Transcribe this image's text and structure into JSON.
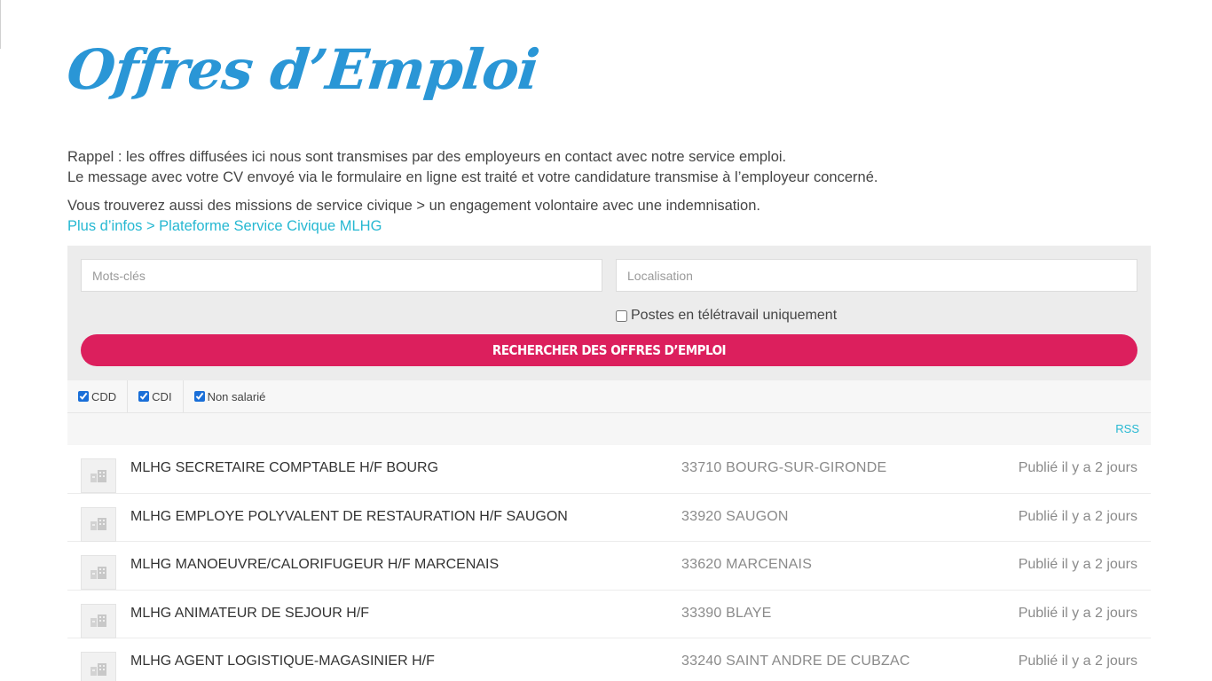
{
  "title": "Offres d’Emploi",
  "intro": {
    "line1": "Rappel : les offres diffusées ici nous sont transmises par des employeurs en contact avec notre service emploi.",
    "line2": "Le message avec votre CV envoyé via le formulaire en ligne est traité et votre candidature transmise à l’employeur concerné.",
    "line3": "Vous trouverez aussi des missions de service civique > un engagement volontaire avec une indemnisation.",
    "link": "Plus d’infos > Plateforme Service Civique MLHG"
  },
  "search": {
    "keywords_placeholder": "Mots-clés",
    "location_placeholder": "Localisation",
    "remote_label": "Postes en télétravail uniquement",
    "button_label": "Rechercher des offres d’emploi"
  },
  "job_types": [
    {
      "label": "CDD",
      "checked": true
    },
    {
      "label": "CDI",
      "checked": true
    },
    {
      "label": "Non salarié",
      "checked": true
    }
  ],
  "rss_label": "RSS",
  "jobs": [
    {
      "title": "MLHG SECRETAIRE COMPTABLE H/F BOURG",
      "location": "33710 BOURG-SUR-GIRONDE",
      "date": "Publié il y a 2 jours"
    },
    {
      "title": "MLHG EMPLOYE POLYVALENT DE RESTAURATION H/F SAUGON",
      "location": "33920 SAUGON",
      "date": "Publié il y a 2 jours"
    },
    {
      "title": "MLHG MANOEUVRE/CALORIFUGEUR H/F MARCENAIS",
      "location": "33620 MARCENAIS",
      "date": "Publié il y a 2 jours"
    },
    {
      "title": "MLHG ANIMATEUR DE SEJOUR H/F",
      "location": "33390 BLAYE",
      "date": "Publié il y a 2 jours"
    },
    {
      "title": "MLHG AGENT LOGISTIQUE-MAGASINIER H/F",
      "location": "33240 SAINT ANDRE DE CUBZAC",
      "date": "Publié il y a 2 jours"
    }
  ],
  "colors": {
    "title": "#2a96d6",
    "button": "#dc1f5d",
    "link": "#26b8d2"
  },
  "icons": {
    "company_logo": "building-icon"
  }
}
